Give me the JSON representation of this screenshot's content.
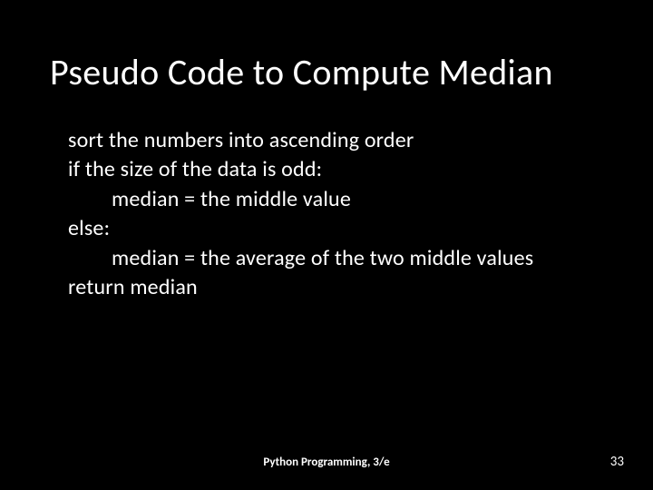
{
  "slide": {
    "title": "Pseudo Code to Compute Median",
    "lines": {
      "l1": "sort the numbers into ascending order",
      "l2": "if the size of the data is odd:",
      "l3": "median = the middle value",
      "l4": "else:",
      "l5": "median = the average of the two middle values",
      "l6": "return median"
    },
    "footer": {
      "source": "Python Programming, 3/e",
      "page": "33"
    }
  }
}
